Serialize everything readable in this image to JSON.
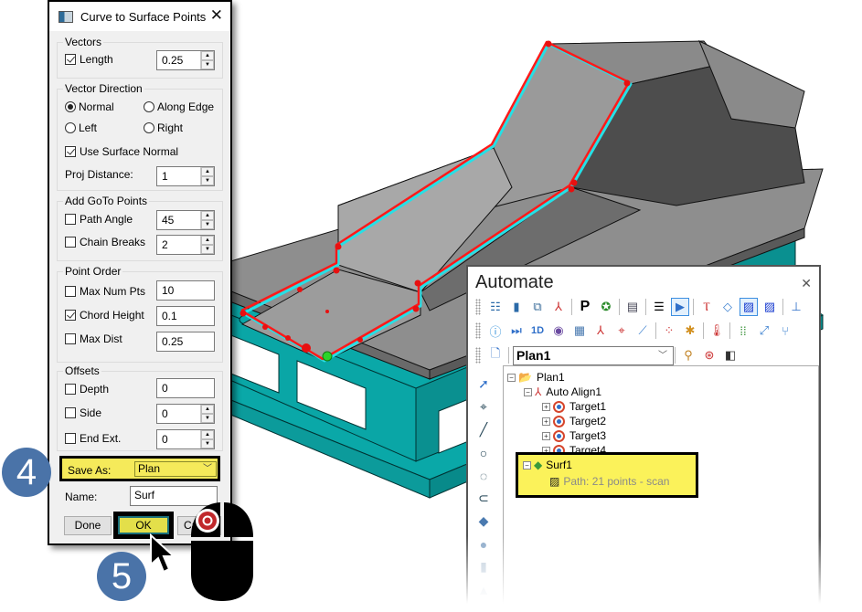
{
  "dialog": {
    "title": "Curve to Surface Points",
    "close_icon": "close-icon",
    "groups": {
      "vectors": {
        "label": "Vectors",
        "length": {
          "label": "Length",
          "checked": true,
          "value": "0.25"
        }
      },
      "vector_direction": {
        "label": "Vector Direction",
        "options": [
          {
            "label": "Normal",
            "selected": true
          },
          {
            "label": "Along Edge",
            "selected": false
          },
          {
            "label": "Left",
            "selected": false
          },
          {
            "label": "Right",
            "selected": false
          }
        ],
        "use_surface_normal": {
          "label": "Use Surface Normal",
          "checked": true
        },
        "proj_distance": {
          "label": "Proj Distance:",
          "value": "1"
        }
      },
      "add_goto_points": {
        "label": "Add GoTo Points",
        "path_angle": {
          "label": "Path Angle",
          "checked": false,
          "value": "45"
        },
        "chain_breaks": {
          "label": "Chain Breaks",
          "checked": false,
          "value": "2"
        }
      },
      "point_order": {
        "label": "Point Order",
        "max_num_pts": {
          "label": "Max Num Pts",
          "checked": false,
          "value": "10"
        },
        "chord_height": {
          "label": "Chord Height",
          "checked": true,
          "value": "0.1"
        },
        "max_dist": {
          "label": "Max Dist",
          "checked": false,
          "value": "0.25"
        }
      },
      "offsets": {
        "label": "Offsets",
        "depth": {
          "label": "Depth",
          "checked": false,
          "value": "0"
        },
        "side": {
          "label": "Side",
          "checked": false,
          "value": "0"
        },
        "end_ext": {
          "label": "End Ext.",
          "checked": false,
          "value": "0"
        }
      }
    },
    "save_as": {
      "label": "Save As:",
      "value": "Plan"
    },
    "name": {
      "label": "Name:",
      "value": "Surf"
    },
    "buttons": {
      "done": "Done",
      "ok": "OK",
      "cancel": "Ca"
    }
  },
  "callouts": {
    "step4": "4",
    "step5": "5"
  },
  "automate": {
    "title": "Automate",
    "toolbar_row1": [
      "checklist-icon",
      "book-icon",
      "camera-icon",
      "axes-icon",
      "p-icon",
      "probe-icon",
      "report-icon",
      "list-icon",
      "play-icon",
      "robot-icon",
      "tag-icon",
      "scan-path-icon",
      "scan-path-colored-icon",
      "anchor-icon"
    ],
    "toolbar_row2": [
      "info-icon",
      "step-icon",
      "1d-icon",
      "vision-icon",
      "grid-icon",
      "align-icon",
      "align-target-icon",
      "chart-icon",
      "targets-icon",
      "cluster-icon",
      "thermometer-icon",
      "dots-icon",
      "vector-icon",
      "split-icon"
    ],
    "plan_select": "Plan1",
    "tree": {
      "root": "Plan1",
      "align": "Auto Align1",
      "targets": [
        "Target1",
        "Target2",
        "Target3",
        "Target4"
      ],
      "surf": "Surf1",
      "path": "Path: 21 points - scan"
    }
  },
  "colors": {
    "highlight": "#f5ea5a",
    "badge": "#4a73a8",
    "model_teal": "#0aa8a8",
    "model_gray": "#8c8c8c",
    "path_red": "#ff1a1a",
    "path_cyan": "#25e0e6"
  }
}
